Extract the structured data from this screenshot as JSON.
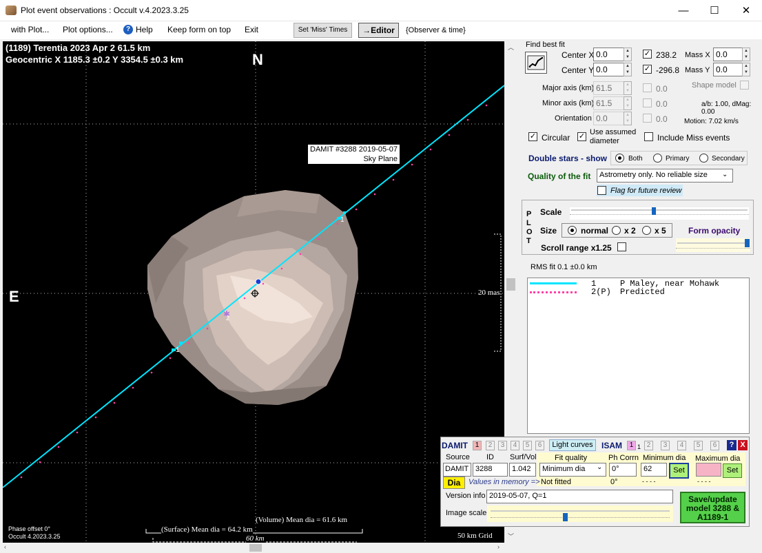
{
  "window": {
    "title": "Plot event observations : Occult v.4.2023.3.25",
    "minimize": "—",
    "maximize": "☐",
    "close": "✕"
  },
  "menu": {
    "with_plot": "with Plot...",
    "plot_options": "Plot options...",
    "help": "Help",
    "keep_form": "Keep form on top",
    "exit": "Exit",
    "set_miss": "Set 'Miss' Times",
    "editor": "→Editor",
    "observer": "{Observer & time}"
  },
  "plot": {
    "line1": "(1189) Terentia  2023 Apr 2   61.5 km",
    "line2": "Geocentric  X  1185.3 ±0.2  Y 3354.5 ±0.3 km",
    "north": "N",
    "east": "E",
    "damit_tag": "DAMIT #3288 2019-05-07",
    "sky_plane": "Sky Plane",
    "mas": "20 mas",
    "chord1a": "1",
    "chord1b": "1",
    "chord2": "2",
    "phase": "Phase offset 0°",
    "occult": "Occult 4.2023.3.25",
    "vol": "(Volume) Mean dia = 61.6 km",
    "surf": "(Surface) Mean dia = 64.2 km",
    "km60": "60 km",
    "grid": "50 km Grid"
  },
  "fit": {
    "header": "Find best fit",
    "cx_label": "Center X",
    "cx": "0.0",
    "cy_label": "Center Y",
    "cy": "0.0",
    "x_fit": "238.2",
    "y_fit": "-296.8",
    "massx_label": "Mass X",
    "massx": "0.0",
    "massy_label": "Mass Y",
    "massy": "0.0",
    "major_label": "Major axis (km)",
    "major": "61.5",
    "minor_label": "Minor axis (km)",
    "minor": "61.5",
    "orient_label": "Orientation",
    "orient": "0.0",
    "g1": "0.0",
    "g2": "0.0",
    "g3": "0.0",
    "shape_model": "Shape model",
    "ab": "a/b: 1.00, dMag: 0.00",
    "motion": "Motion: 7.02 km/s",
    "circular": "Circular",
    "assumed1": "Use assumed",
    "assumed2": "diameter",
    "include_miss": "Include Miss events",
    "dbl_label": "Double stars - show",
    "both": "Both",
    "primary": "Primary",
    "secondary": "Secondary",
    "quality_label": "Quality of the fit",
    "quality_value": "Astrometry only. No reliable size",
    "flag": "Flag for future review"
  },
  "plotbox": {
    "letters": [
      "P",
      "L",
      "O",
      "T"
    ],
    "scale": "Scale",
    "size": "Size",
    "normal": "normal",
    "x2": "x 2",
    "x5": "x 5",
    "form_opacity": "Form opacity",
    "scroll_range": "Scroll range x1.25",
    "rms": "RMS fit 0.1 ±0.0 km",
    "scale_value": 0.46,
    "opacity_value": 1.0
  },
  "legend": [
    {
      "num": "1",
      "name": "P Maley, near Mohawk",
      "color": "#00e5ff",
      "style": "solid"
    },
    {
      "num": "2(P)",
      "name": "Predicted",
      "color": "#ff3fa6",
      "style": "dots"
    }
  ],
  "damit": {
    "damit": "DAMIT",
    "isam": "ISAM",
    "nums": [
      "1",
      "2",
      "3",
      "4",
      "5",
      "6"
    ],
    "light_curves": "Light curves",
    "source_h": "Source",
    "id_h": "ID",
    "sv_h": "Surf/Vol",
    "source": "DAMIT",
    "id": "3288",
    "sv": "1.042",
    "fitq_h": "Fit quality",
    "phcorr_h": "Ph Corrn",
    "min_h": "Minimum dia",
    "max_h": "Maximum dia",
    "fitq": "Minimum dia",
    "phcorr": "0°",
    "min": "62",
    "set": "Set",
    "not_fitted": "Not fitted",
    "phcorr2": "0°",
    "dashes1": "- - - -",
    "dashes2": "- - - -",
    "dia": "Dia",
    "values_mem": "Values in memory =>",
    "version_label": "Version info",
    "version": "2019-05-07, Q=1",
    "img_label": "Image scale",
    "save": "Save/update model 3288 & A1189-1",
    "image_scale_value": 0.43
  }
}
